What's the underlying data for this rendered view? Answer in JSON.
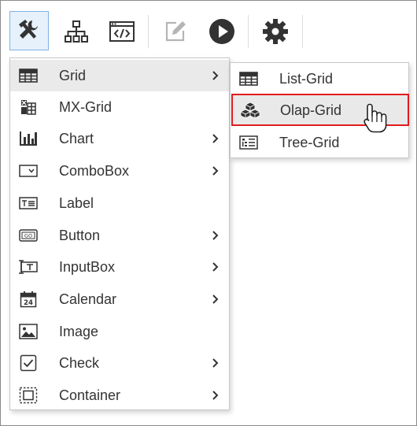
{
  "toolbar": {
    "buttons": [
      {
        "name": "design-tools",
        "icon": "tools-icon",
        "selected": true
      },
      {
        "name": "hierarchy",
        "icon": "hierarchy-icon"
      },
      {
        "name": "code",
        "icon": "code-window-icon"
      },
      {
        "name": "edit",
        "icon": "edit-icon",
        "disabled": true
      },
      {
        "name": "run",
        "icon": "play-icon"
      },
      {
        "name": "settings",
        "icon": "gear-icon"
      }
    ]
  },
  "main_menu": {
    "items": [
      {
        "label": "Grid",
        "icon": "grid-icon",
        "has_submenu": true,
        "active": true
      },
      {
        "label": "MX-Grid",
        "icon": "mx-grid-icon",
        "has_submenu": false
      },
      {
        "label": "Chart",
        "icon": "bar-chart-icon",
        "has_submenu": true
      },
      {
        "label": "ComboBox",
        "icon": "combobox-icon",
        "has_submenu": true
      },
      {
        "label": "Label",
        "icon": "label-icon",
        "has_submenu": false
      },
      {
        "label": "Button",
        "icon": "button-icon",
        "has_submenu": true
      },
      {
        "label": "InputBox",
        "icon": "inputbox-icon",
        "has_submenu": true
      },
      {
        "label": "Calendar",
        "icon": "calendar-icon",
        "has_submenu": true
      },
      {
        "label": "Image",
        "icon": "image-icon",
        "has_submenu": false
      },
      {
        "label": "Check",
        "icon": "checkbox-icon",
        "has_submenu": true
      },
      {
        "label": "Container",
        "icon": "container-icon",
        "has_submenu": true
      }
    ]
  },
  "sub_menu": {
    "items": [
      {
        "label": "List-Grid",
        "icon": "list-grid-icon"
      },
      {
        "label": "Olap-Grid",
        "icon": "olap-cubes-icon",
        "highlighted": true
      },
      {
        "label": "Tree-Grid",
        "icon": "tree-grid-icon"
      }
    ]
  },
  "colors": {
    "icon_dark": "#333333",
    "icon_disabled": "#b5b5b5",
    "selected_bg": "#e6f1fb",
    "selected_border": "#7fb1e3",
    "highlight_border": "#e21b1b",
    "hover_bg": "#eaeaea"
  }
}
